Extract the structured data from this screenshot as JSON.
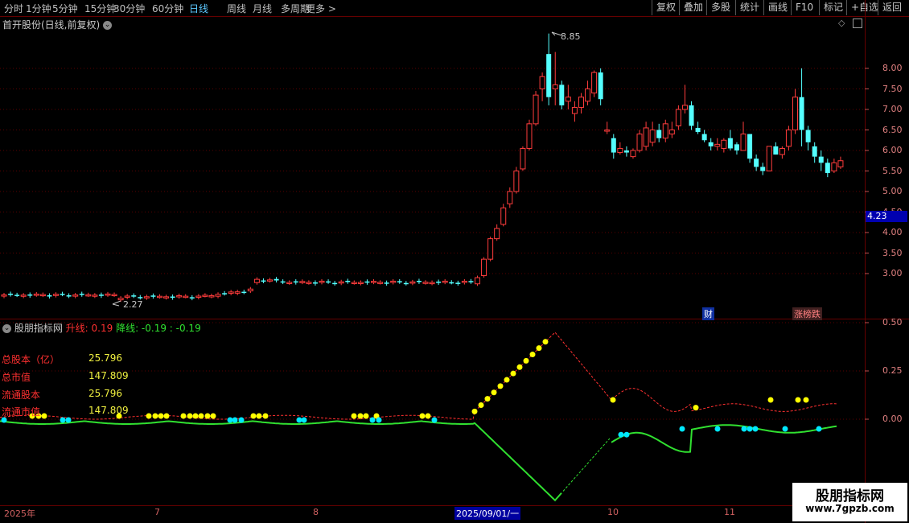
{
  "toolbar": {
    "periods": [
      "分时",
      "1分钟",
      "5分钟",
      "15分钟",
      "30分钟",
      "60分钟",
      "日线",
      "周线",
      "月线",
      "多周期",
      "更多 >"
    ],
    "active_period": "日线",
    "right_buttons": [
      "复权",
      "叠加",
      "多股",
      "统计",
      "画线",
      "F10",
      "标记",
      "+自选",
      "返回"
    ]
  },
  "main_panel": {
    "title": "首开股份(日线,前复权)",
    "high_label": "8.85",
    "low_label": "2.27",
    "current_price_tag": "4.23",
    "y_ticks": [
      "8.00",
      "7.50",
      "7.00",
      "6.50",
      "6.00",
      "5.50",
      "5.00",
      "4.50",
      "4.00",
      "3.50",
      "3.00"
    ],
    "event_tags": [
      "财",
      "涨榜跌"
    ]
  },
  "indicator_panel": {
    "name": "股朋指标网",
    "up_label": "升线: 0.19",
    "down_label": "降线: -0.19 : -0.19",
    "y_ticks": [
      "0.50",
      "0.25",
      "0.00"
    ],
    "info": [
      {
        "label": "总股本（亿）",
        "value": "25.796"
      },
      {
        "label": "总市值",
        "value": "147.809"
      },
      {
        "label": "流通股本",
        "value": "25.796"
      },
      {
        "label": "流通市值",
        "value": "147.809"
      }
    ]
  },
  "x_axis": [
    "2025年",
    "7",
    "8",
    "2025/09/01/一",
    "10",
    "11"
  ],
  "watermark": {
    "title": "股朋指标网",
    "url": "www.7gpzb.com"
  },
  "colors": {
    "up": "#ff3c3c",
    "down": "#54ffff",
    "up_line": "#ff3030",
    "down_line": "#30e030",
    "dot_yellow": "#ffff00",
    "dot_cyan": "#00e8ff"
  }
}
